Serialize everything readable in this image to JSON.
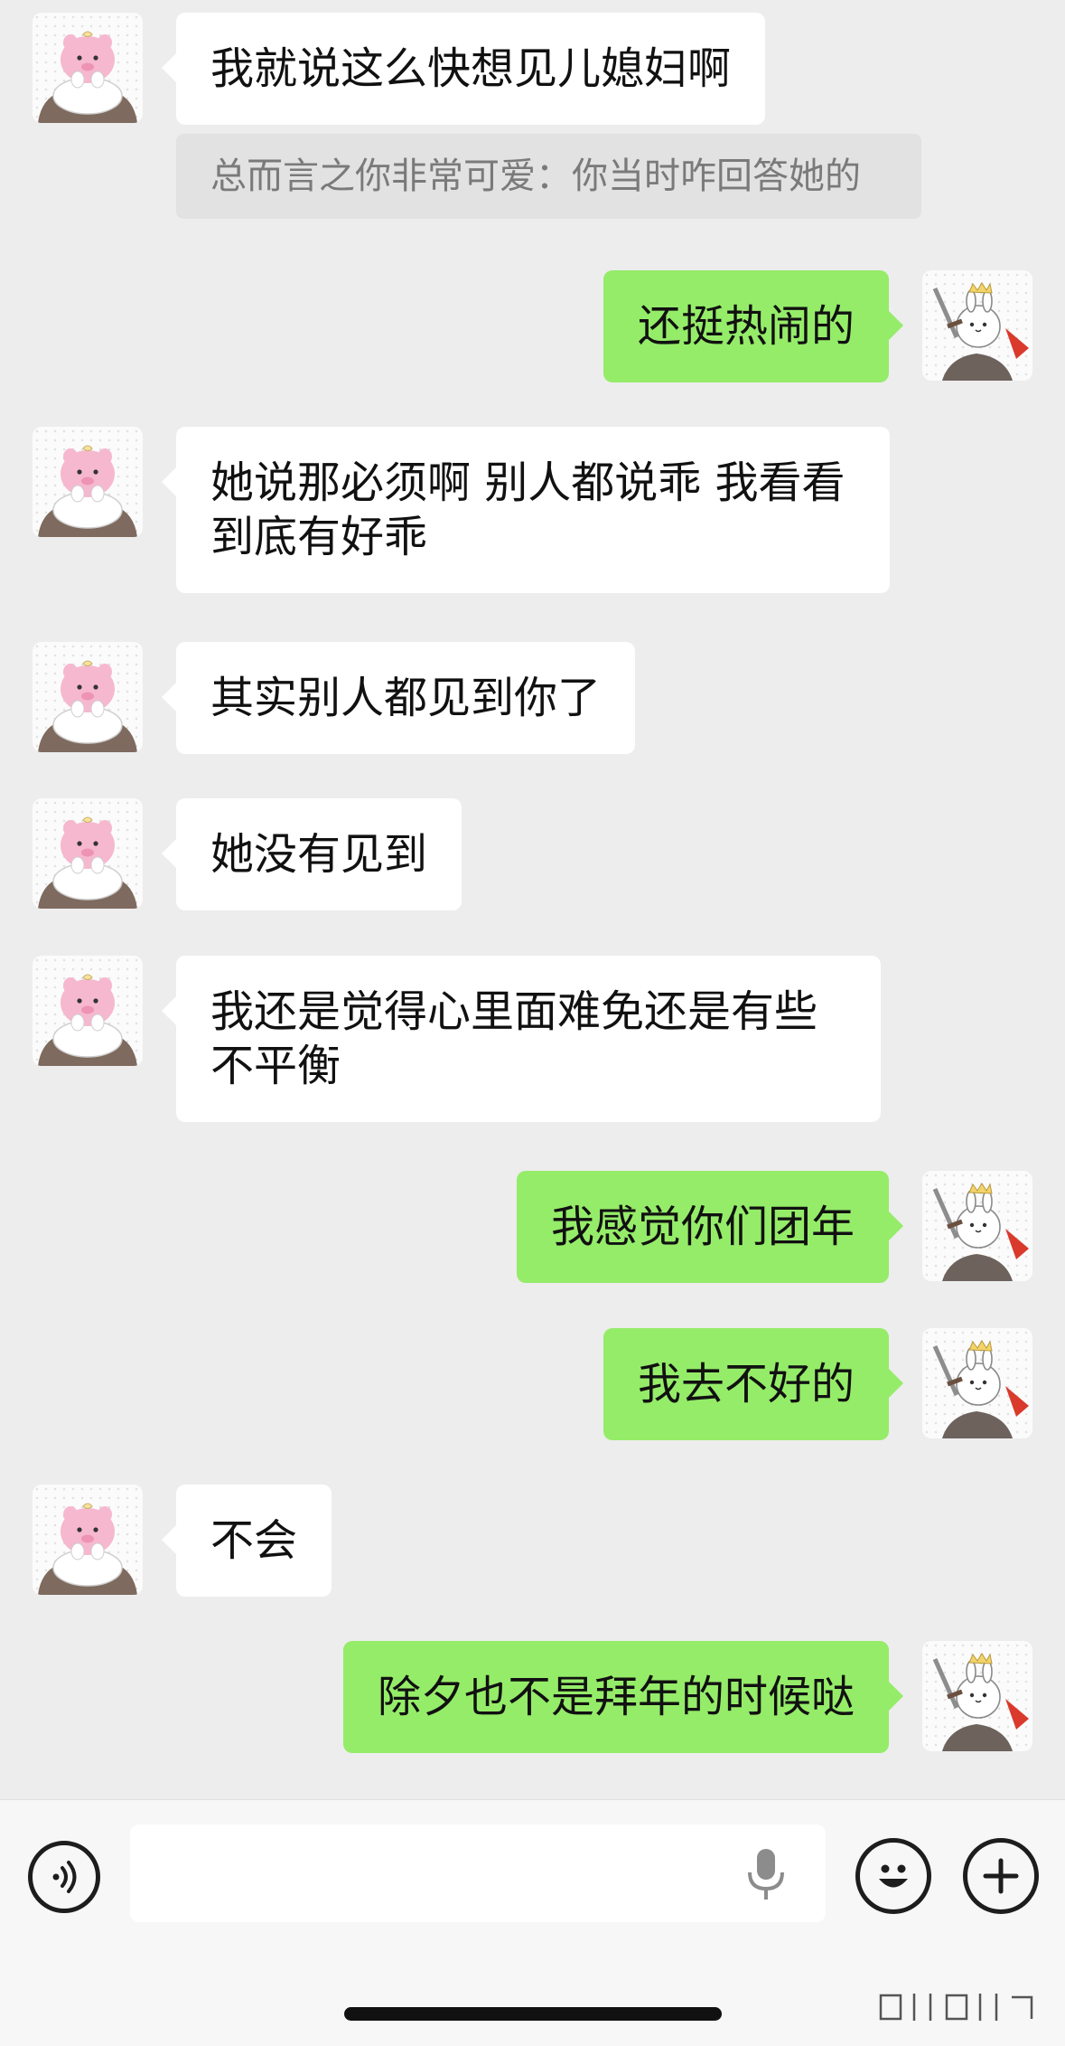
{
  "messages": [
    {
      "side": "left",
      "text": "我就说这么快想见儿媳妇啊",
      "quote": "总而言之你非常可爱：你当时咋回答她的"
    },
    {
      "side": "right",
      "text": "还挺热闹的"
    },
    {
      "side": "left",
      "text": "她说那必须啊 别人都说乖 我看看到底有好乖"
    },
    {
      "side": "left",
      "text": "其实别人都见到你了"
    },
    {
      "side": "left",
      "text": "她没有见到"
    },
    {
      "side": "left",
      "text": "我还是觉得心里面难免还是有些不平衡"
    },
    {
      "side": "right",
      "text": "我感觉你们团年"
    },
    {
      "side": "right",
      "text": "我去不好的"
    },
    {
      "side": "left",
      "text": "不会"
    },
    {
      "side": "right",
      "text": "除夕也不是拜年的时候哒"
    }
  ],
  "input_bar": {
    "value": "",
    "icons": [
      "voice-icon",
      "mic-icon",
      "emoji-icon",
      "plus-icon"
    ]
  },
  "colors": {
    "background": "#ededed",
    "self_bubble": "#95ec69",
    "other_bubble": "#ffffff",
    "quote_bg": "#e2e2e2"
  }
}
